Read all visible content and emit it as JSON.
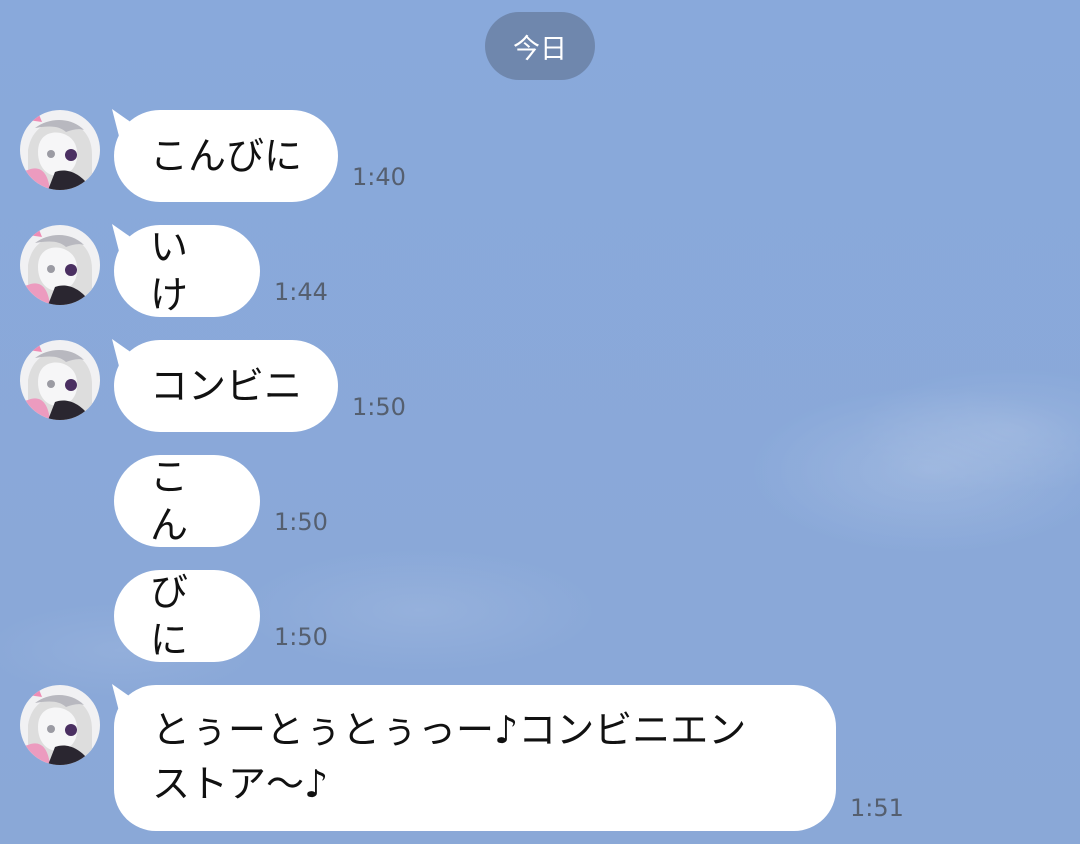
{
  "date_label": "今日",
  "messages": [
    {
      "text": "こんびに",
      "time": "1:40",
      "avatar": true
    },
    {
      "text": "いけ",
      "time": "1:44",
      "avatar": true
    },
    {
      "text": "コンビニ",
      "time": "1:50",
      "avatar": true
    },
    {
      "text": "こん",
      "time": "1:50",
      "avatar": false
    },
    {
      "text": "びに",
      "time": "1:50",
      "avatar": false
    },
    {
      "text_line1": "とぅーとぅとぅっー♪コンビニエン",
      "text_line2": "ストア〜♪",
      "time": "1:51",
      "avatar": true
    }
  ],
  "colors": {
    "background": "#8aa8d8",
    "bubble": "#ffffff",
    "date_pill": "#6f87ad",
    "time_text": "#555f6f"
  },
  "icons": {
    "avatar": "anime-avatar-icon"
  }
}
